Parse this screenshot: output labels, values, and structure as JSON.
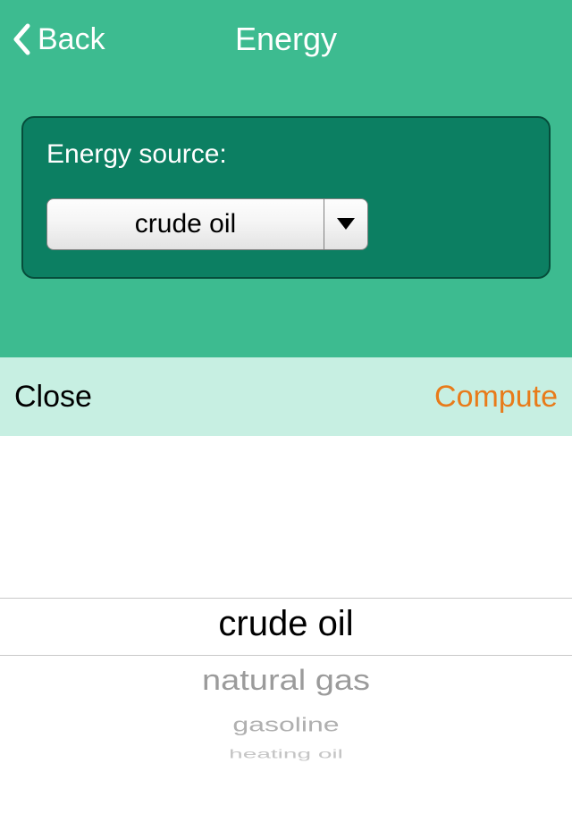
{
  "nav": {
    "back_label": "Back",
    "title": "Energy"
  },
  "card": {
    "label": "Energy source:",
    "selected": "crude oil"
  },
  "actions": {
    "close": "Close",
    "compute": "Compute"
  },
  "picker": {
    "items": [
      "crude oil",
      "natural gas",
      "gasoline",
      "heating oil"
    ]
  }
}
